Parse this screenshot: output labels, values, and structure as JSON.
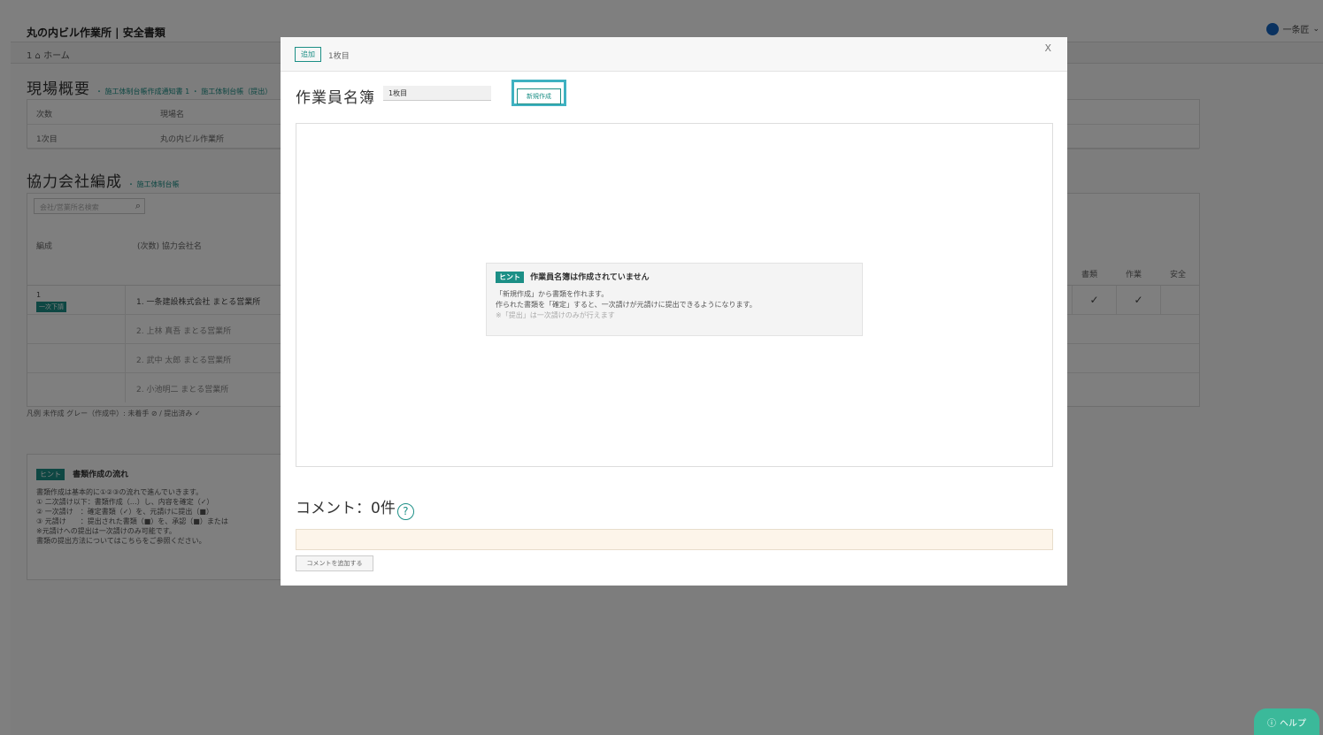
{
  "app": {
    "title": "丸の内ビル作業所 | 安全書類",
    "user_name": "一条匠",
    "breadcrumb": "1 ⌂ ホーム"
  },
  "background": {
    "overview_title": "現場概要",
    "overview_links": "・ 施工体制台帳作成通知書 1 ・ 施工体制台帳（提出）",
    "summary_headers": [
      "次数",
      "現場名"
    ],
    "summary_values": [
      "1次目",
      "丸の内ビル作業所"
    ],
    "company_title": "協力会社編成",
    "company_link": "・ 施工体制台帳",
    "search_placeholder": "会社/営業所名検索",
    "table_headers": [
      "編成",
      "(次数) 協力会社名"
    ],
    "col_headers": [
      "書類",
      "作業",
      "安全"
    ],
    "rows": [
      {
        "name": "1. 一条建設株式会社 まとる営業所",
        "badge": "一次下請",
        "checks": [
          "✓",
          "✓"
        ]
      },
      {
        "name": "2. 上林 真吾 まとる営業所"
      },
      {
        "name": "2. 武中 太郎 まとる営業所"
      },
      {
        "name": "2. 小池明二 まとる営業所"
      }
    ],
    "legend": "凡例 未作成 グレー（作成中）: 未着手 ⊘ / 提出済み ✓",
    "hint_tag": "ヒント",
    "hint_title": "書類作成の流れ",
    "hint_lines": [
      "書類作成は基本的に①②③の流れで進んでいきます。",
      "① 二次請け以下：書類作成（…）し、内容を確定（✓）",
      "② 一次請け　：確定書類（✓）を、元請けに提出（■）",
      "③ 元請け　　：提出された書類（■）を、承認（■）または",
      "※元請けへの提出は一次請けのみ可能です。",
      "書類の提出方法についてはこちらをご参照ください。"
    ],
    "help_label": "ヘルプ"
  },
  "modal": {
    "tag_label": "追加",
    "sheet_label": "1枚目",
    "close_label": "X",
    "doc_title": "作業員名簿",
    "sheet_select_value": "1枚目",
    "new_button_label": "新規作成",
    "hint_tag": "ヒント",
    "empty_title": "作業員名簿は作成されていません",
    "empty_line1": "「新規作成」から書類を作れます。",
    "empty_line2": "作られた書類を「確定」すると、一次請けが元請けに提出できるようになります。",
    "empty_note": "※「提出」は一次請けのみが行えます",
    "comment_title": "コメント：0件",
    "comment_help": "?",
    "comment_submit": "コメントを追加する"
  },
  "colors": {
    "accent": "#1c8f86",
    "highlight": "#3fb1c1",
    "comment_bg": "#fdf5ea"
  }
}
